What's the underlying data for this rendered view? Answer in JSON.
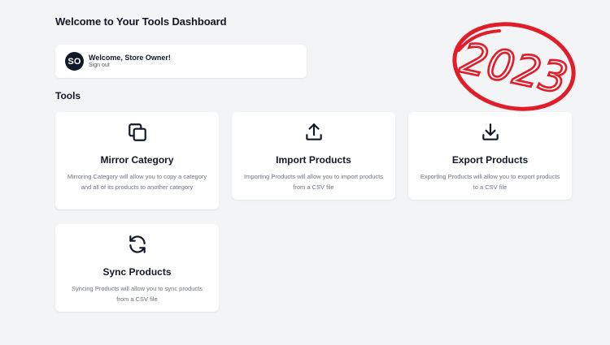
{
  "header": {
    "title": "Welcome to Your Tools Dashboard"
  },
  "user": {
    "initials": "SO",
    "welcome": "Welcome, Store Owner!",
    "sign_out": "Sign out"
  },
  "tools_section": {
    "title": "Tools",
    "items": [
      {
        "icon": "copy-icon",
        "title": "Mirror Category",
        "description": "Mirroring Category will allow you to copy a category and all of its products to another category"
      },
      {
        "icon": "upload-icon",
        "title": "Import Products",
        "description": "Importing Products will allow you to import products from a CSV file"
      },
      {
        "icon": "download-icon",
        "title": "Export Products",
        "description": "Exporting Products will allow you to export products to a CSV file"
      },
      {
        "icon": "sync-icon",
        "title": "Sync Products",
        "description": "Syncing Products will allow you to sync products from a CSV file"
      }
    ]
  },
  "stamp": {
    "text": "2023",
    "color": "#e11d2a"
  },
  "colors": {
    "background": "#f3f4f6",
    "card": "#ffffff",
    "text": "#111827",
    "muted": "#6b7280"
  }
}
